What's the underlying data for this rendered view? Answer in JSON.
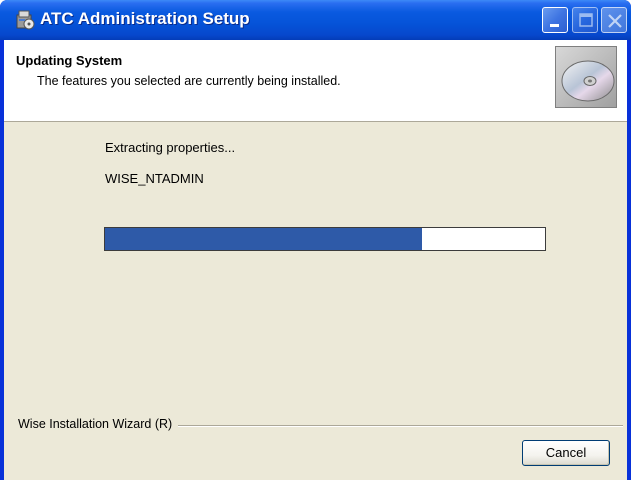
{
  "window": {
    "title": "ATC Administration Setup"
  },
  "header": {
    "title": "Updating System",
    "subtitle": "The features you selected are currently being installed."
  },
  "status": {
    "action": "Extracting properties...",
    "item": "WISE_NTADMIN"
  },
  "progress": {
    "fraction": 0.72
  },
  "footer": {
    "branding": "Wise Installation Wizard (R)",
    "cancel_label": "Cancel"
  },
  "icons": {
    "app": "installer-icon",
    "header_image": "cd-disc-icon",
    "minimize": "minimize-icon",
    "maximize": "maximize-icon",
    "close": "close-icon"
  },
  "colors": {
    "titlebar": "#0553d8",
    "progress_fill": "#2e5aa8",
    "dialog_bg": "#ece9d8"
  }
}
